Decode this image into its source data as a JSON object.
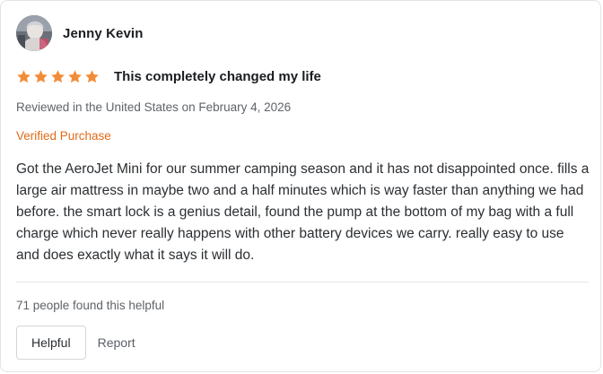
{
  "review": {
    "author": {
      "name": "Jenny Kevin",
      "avatar_icon": "user-photo"
    },
    "rating": {
      "stars": 5,
      "max": 5,
      "star_color": "#f28c38"
    },
    "title": "This completely changed my life",
    "meta": "Reviewed in the United States on February 4, 2026",
    "verified_label": "Verified Purchase",
    "verified_color": "#e06a17",
    "body": "Got the AeroJet Mini for our summer camping season and it has not disappointed once. fills a large air mattress in maybe two and a half minutes which is way faster than anything we had before. the smart lock is a genius detail, found the pump at the bottom of my bag with a full charge which never really happens with other battery devices we carry. really easy to use and does exactly what it says it will do.",
    "helpful_count_text": "71 people found this helpful",
    "actions": {
      "helpful_label": "Helpful",
      "report_label": "Report"
    }
  }
}
